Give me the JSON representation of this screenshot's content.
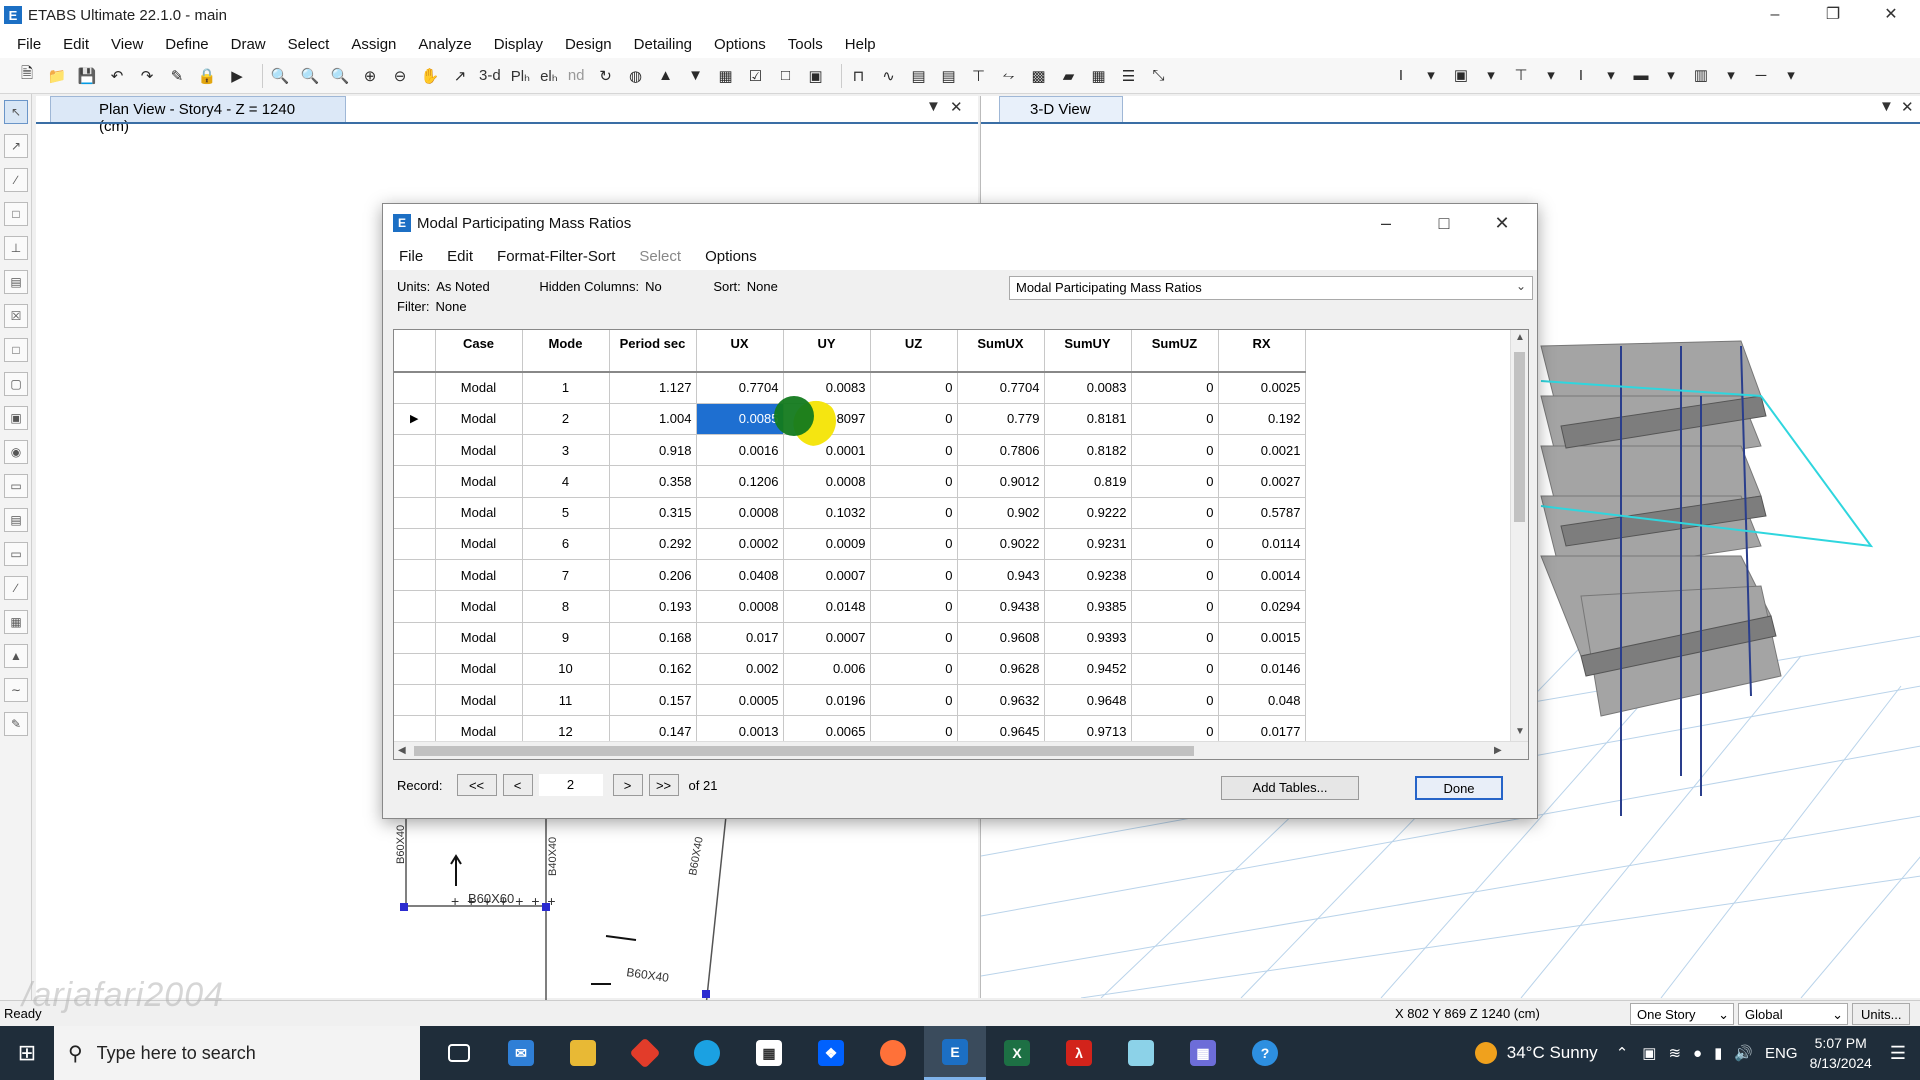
{
  "window": {
    "title": "ETABS Ultimate 22.1.0 - main",
    "app_icon_letter": "E",
    "controls": [
      "–",
      "❐",
      "✕"
    ]
  },
  "menubar": [
    "File",
    "Edit",
    "View",
    "Define",
    "Draw",
    "Select",
    "Assign",
    "Analyze",
    "Display",
    "Design",
    "Detailing",
    "Options",
    "Tools",
    "Help"
  ],
  "toolbar": {
    "view_3d_label": "3-d",
    "plan_label": "Plₕ",
    "elev_label": "elₕ",
    "nd_label": "nd"
  },
  "plan_view": {
    "tab_title": "Plan View - Story4 - Z = 1240 (cm)",
    "labels": [
      "B60X40",
      "B60X60",
      "B40X40",
      "B60X40",
      "B60X40"
    ]
  },
  "view_3d": {
    "tab_title": "3-D View"
  },
  "dialog": {
    "title": "Modal Participating Mass Ratios",
    "icon_letter": "E",
    "menu": [
      "File",
      "Edit",
      "Format-Filter-Sort",
      "Select",
      "Options"
    ],
    "units_label": "Units:",
    "units_value": "As Noted",
    "hidden_label": "Hidden Columns:",
    "hidden_value": "No",
    "sort_label": "Sort:",
    "sort_value": "None",
    "filter_label": "Filter:",
    "filter_value": "None",
    "table_select": "Modal Participating Mass Ratios",
    "columns": [
      "Case",
      "Mode",
      "Period sec",
      "UX",
      "UY",
      "UZ",
      "SumUX",
      "SumUY",
      "SumUZ",
      "RX"
    ],
    "rows": [
      [
        "Modal",
        "1",
        "1.127",
        "0.7704",
        "0.0083",
        "0",
        "0.7704",
        "0.0083",
        "0",
        "0.0025"
      ],
      [
        "Modal",
        "2",
        "1.004",
        "0.0085",
        "0.8097",
        "0",
        "0.779",
        "0.8181",
        "0",
        "0.192"
      ],
      [
        "Modal",
        "3",
        "0.918",
        "0.0016",
        "0.0001",
        "0",
        "0.7806",
        "0.8182",
        "0",
        "0.0021"
      ],
      [
        "Modal",
        "4",
        "0.358",
        "0.1206",
        "0.0008",
        "0",
        "0.9012",
        "0.819",
        "0",
        "0.0027"
      ],
      [
        "Modal",
        "5",
        "0.315",
        "0.0008",
        "0.1032",
        "0",
        "0.902",
        "0.9222",
        "0",
        "0.5787"
      ],
      [
        "Modal",
        "6",
        "0.292",
        "0.0002",
        "0.0009",
        "0",
        "0.9022",
        "0.9231",
        "0",
        "0.0114"
      ],
      [
        "Modal",
        "7",
        "0.206",
        "0.0408",
        "0.0007",
        "0",
        "0.943",
        "0.9238",
        "0",
        "0.0014"
      ],
      [
        "Modal",
        "8",
        "0.193",
        "0.0008",
        "0.0148",
        "0",
        "0.9438",
        "0.9385",
        "0",
        "0.0294"
      ],
      [
        "Modal",
        "9",
        "0.168",
        "0.017",
        "0.0007",
        "0",
        "0.9608",
        "0.9393",
        "0",
        "0.0015"
      ],
      [
        "Modal",
        "10",
        "0.162",
        "0.002",
        "0.006",
        "0",
        "0.9628",
        "0.9452",
        "0",
        "0.0146"
      ],
      [
        "Modal",
        "11",
        "0.157",
        "0.0005",
        "0.0196",
        "0",
        "0.9632",
        "0.9648",
        "0",
        "0.048"
      ],
      [
        "Modal",
        "12",
        "0.147",
        "0.0013",
        "0.0065",
        "0",
        "0.9645",
        "0.9713",
        "0",
        "0.0177"
      ]
    ],
    "current_row_marker": "▶",
    "record_label": "Record:",
    "nav_first": "<<",
    "nav_prev": "<",
    "nav_next": ">",
    "nav_last": ">>",
    "record_value": "2",
    "record_total": "of 21",
    "add_tables_label": "Add Tables...",
    "done_label": "Done"
  },
  "statusbar": {
    "ready": "Ready",
    "coords": "X 802  Y 869  Z 1240 (cm)",
    "story_option": "One Story",
    "coord_system": "Global",
    "units_button": "Units..."
  },
  "watermark": "/arjafari2004",
  "taskbar": {
    "search_placeholder": "Type here to search",
    "weather": "34°C  Sunny",
    "language": "ENG",
    "time": "5:07 PM",
    "date": "8/13/2024"
  },
  "colors": {
    "selection": "#1e6fd1",
    "accent": "#2664c8",
    "taskbar": "#1f2d3a"
  }
}
